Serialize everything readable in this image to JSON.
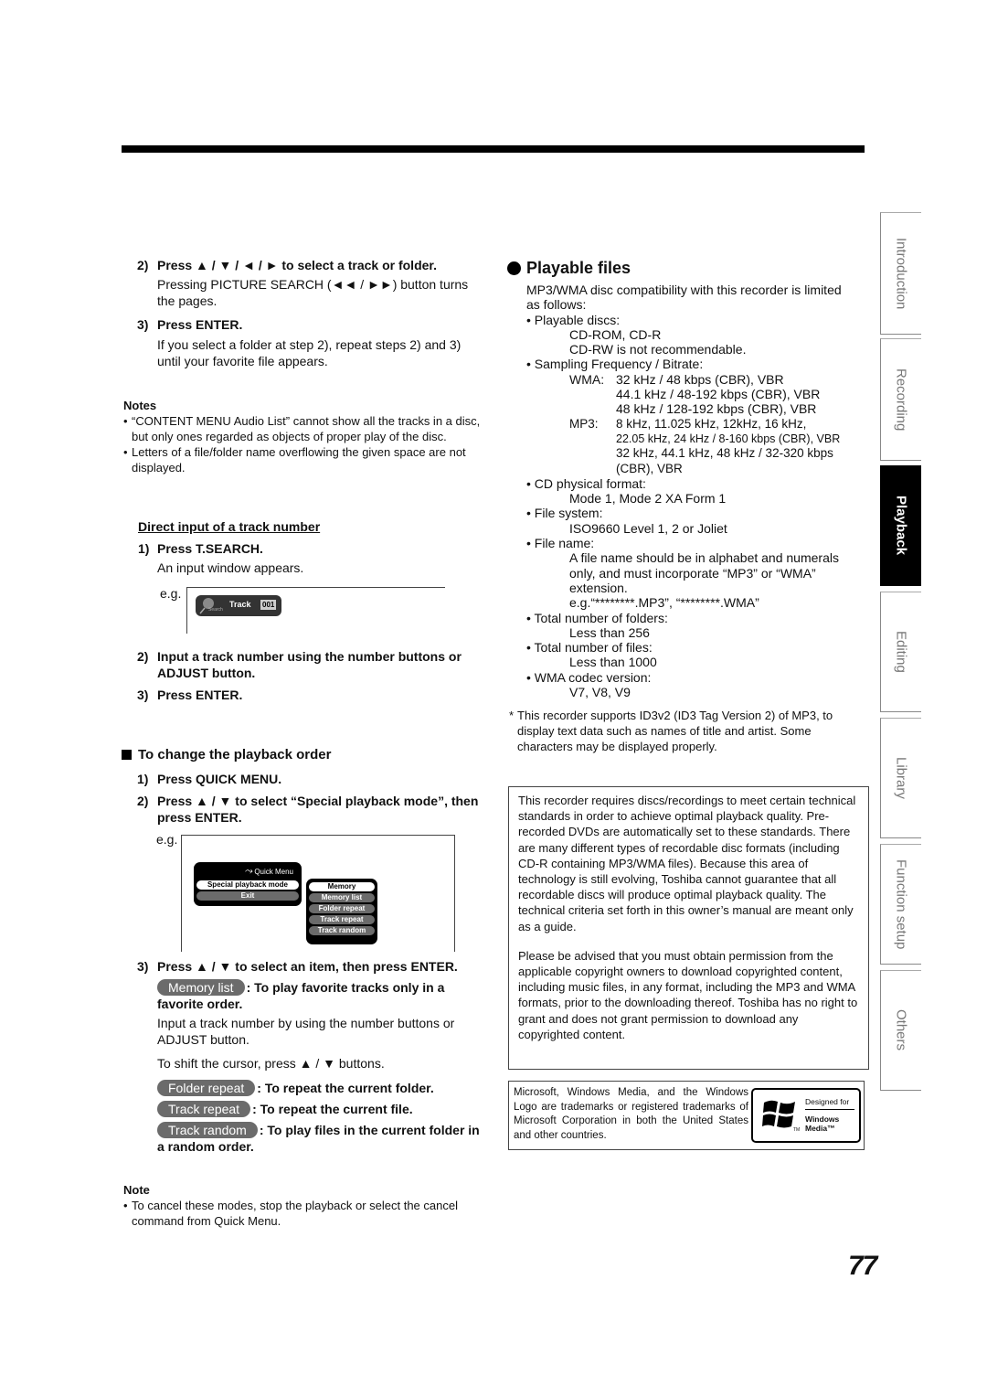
{
  "page": {
    "number": "77"
  },
  "left": {
    "step2": {
      "num": "2)",
      "head": "Press ▲ / ▼ / ◄ / ► to select a track or folder.",
      "body": "Pressing PICTURE SEARCH (◄◄ / ►►) button turns the pages."
    },
    "step3": {
      "num": "3)",
      "head": "Press ENTER.",
      "body": "If you select a folder at step 2), repeat steps 2) and 3) until your favorite file appears."
    },
    "notes": {
      "title": "Notes",
      "items": [
        "“CONTENT MENU Audio List” cannot show all the tracks in a disc, but only ones regarded as objects of proper play of the disc.",
        "Letters of a file/folder name overflowing the given space are not displayed."
      ]
    },
    "direct": {
      "title": "Direct input of a track number",
      "steps": [
        {
          "num": "1)",
          "head": "Press T.SEARCH.",
          "body": "An input window appears."
        },
        {
          "num": "2)",
          "head": "Input a track number using the number buttons or ADJUST button."
        },
        {
          "num": "3)",
          "head": "Press ENTER."
        }
      ],
      "eg_label": "e.g.",
      "osd": {
        "icon_label": "Search",
        "label": "Track",
        "value": "001"
      }
    },
    "order": {
      "title": "To change the playback order",
      "steps": [
        {
          "num": "1)",
          "head": "Press QUICK MENU."
        },
        {
          "num": "2)",
          "head": "Press ▲ / ▼ to select “Special playback mode”, then press ENTER."
        },
        {
          "num": "3)",
          "head": "Press ▲ / ▼ to select an item, then press ENTER."
        }
      ],
      "eg_label": "e.g.",
      "quick_menu": {
        "title": "Quick Menu",
        "items": [
          "Special playback mode",
          "Exit"
        ],
        "sub_items": [
          "Memory",
          "Memory list",
          "Folder repeat",
          "Track repeat",
          "Track random"
        ]
      },
      "options": [
        {
          "pill": "Memory list",
          "desc": ": To play favorite tracks only in a favorite order.",
          "body": "Input a track number by using the number buttons or ADJUST button.",
          "body2": "To shift the cursor, press ▲ / ▼ buttons."
        },
        {
          "pill": "Folder repeat",
          "desc": ": To repeat the current folder."
        },
        {
          "pill": "Track repeat",
          "desc": ": To repeat the current file."
        },
        {
          "pill": "Track random",
          "desc": ": To play files in the current folder in a random order."
        }
      ]
    },
    "note": {
      "title": "Note",
      "text": "To cancel these modes, stop the playback or select the cancel command from Quick Menu."
    }
  },
  "right": {
    "title": "Playable files",
    "intro": "MP3/WMA disc compatibility with this recorder is limited as follows:",
    "discs": {
      "label": "Playable discs:",
      "lines": [
        "CD-ROM, CD-R",
        "CD-RW is not recommendable."
      ]
    },
    "sampling": {
      "label": "Sampling Frequency / Bitrate:",
      "wma_label": "WMA:",
      "wma": [
        "32 kHz / 48 kbps (CBR), VBR",
        "44.1 kHz / 48-192 kbps (CBR), VBR",
        "48 kHz / 128-192 kbps (CBR), VBR"
      ],
      "mp3_label": "MP3:",
      "mp3": [
        "8 kHz, 11.025 kHz, 12kHz, 16 kHz,",
        "22.05 kHz, 24 kHz / 8-160 kbps (CBR), VBR",
        "32 kHz, 44.1 kHz, 48 kHz / 32-320 kbps",
        "(CBR), VBR"
      ]
    },
    "cdformat": {
      "label": "CD physical format:",
      "value": "Mode 1, Mode 2 XA Form 1"
    },
    "filesystem": {
      "label": "File system:",
      "value": "ISO9660 Level 1, 2 or Joliet"
    },
    "filename": {
      "label": "File name:",
      "value": "A file name should be in alphabet and numerals only, and must incorporate “MP3” or “WMA” extension.",
      "example": "e.g.“********.MP3”, “********.WMA”"
    },
    "folders": {
      "label": "Total number of folders:",
      "value": "Less than 256"
    },
    "files": {
      "label": "Total number of files:",
      "value": "Less than 1000"
    },
    "codec": {
      "label": "WMA codec version:",
      "value": "V7, V8, V9"
    },
    "footnote": {
      "mark": "*",
      "text": "This recorder supports ID3v2 (ID3 Tag Version 2) of MP3, to display text data such as names of title and artist. Some characters may be displayed properly."
    },
    "notice1": "This recorder requires discs/recordings to meet certain technical standards in order to achieve optimal playback quality.  Pre-recorded DVDs are automatically set to these standards. There are many different types of recordable disc formats (including CD-R containing MP3/WMA files).  Because this area of technology is still evolving, Toshiba cannot guarantee that all recordable discs will produce optimal playback quality. The technical criteria set forth in this owner’s manual are meant only as a guide.",
    "notice2": "Please be advised that you must obtain permission from the applicable copyright owners to download copyrighted content, including music files, in any format, including the MP3 and WMA formats, prior to the downloading thereof. Toshiba has no right to grant and does not grant permission to download any copyrighted content.",
    "trademark": "Microsoft, Windows Media, and the Windows Logo are trademarks or registered trademarks of Microsoft Corporation in both the United States and other countries.",
    "logo": {
      "designed_for": "Designed for",
      "brand1": "Windows",
      "brand2": "Media™",
      "tm": "TM"
    }
  },
  "side_tabs": [
    {
      "label": "Introduction",
      "active": false
    },
    {
      "label": "Recording",
      "active": false
    },
    {
      "label": "Playback",
      "active": true
    },
    {
      "label": "Editing",
      "active": false
    },
    {
      "label": "Library",
      "active": false
    },
    {
      "label": "Function setup",
      "active": false
    },
    {
      "label": "Others",
      "active": false
    }
  ]
}
